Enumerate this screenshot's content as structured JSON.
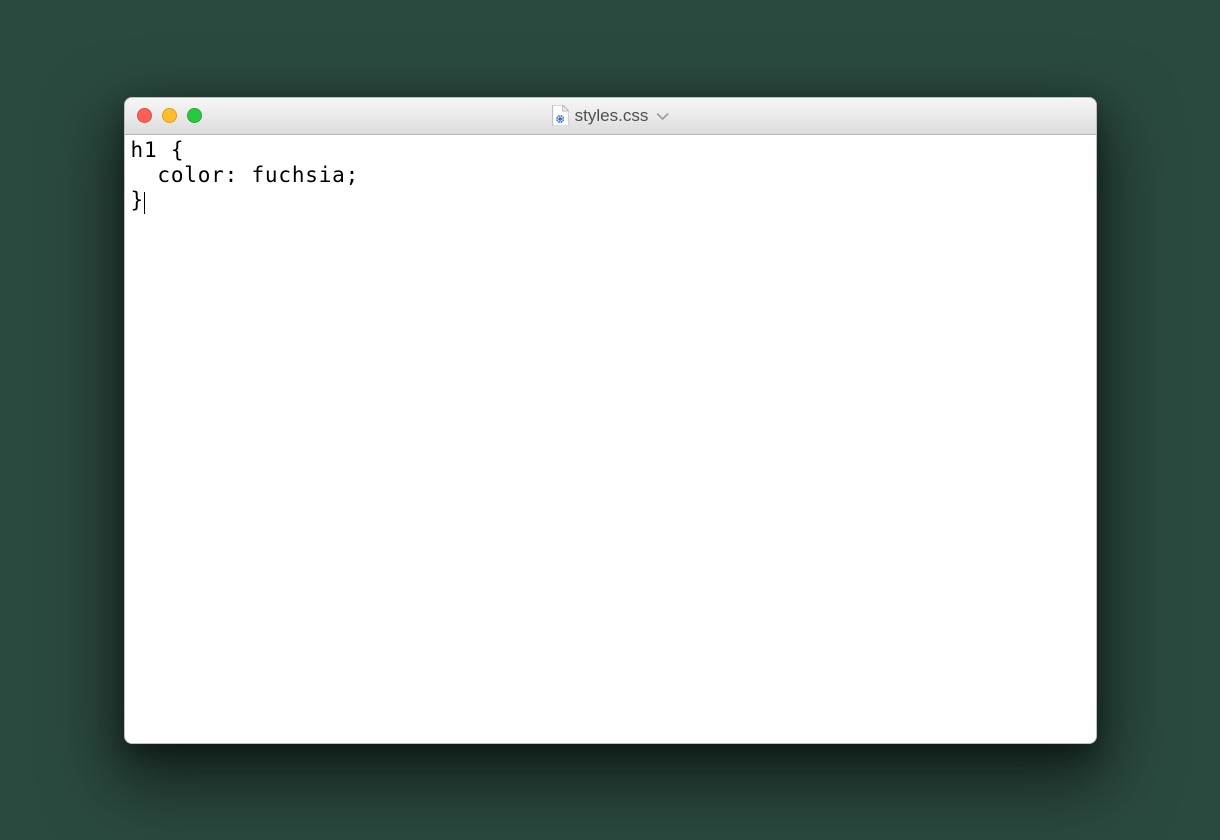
{
  "window": {
    "title": "styles.css",
    "traffic_lights": {
      "close": "close",
      "minimize": "minimize",
      "zoom": "zoom"
    }
  },
  "editor": {
    "content": {
      "line1": "h1 {",
      "line2": "  color: fuchsia;",
      "line3": "}"
    }
  }
}
